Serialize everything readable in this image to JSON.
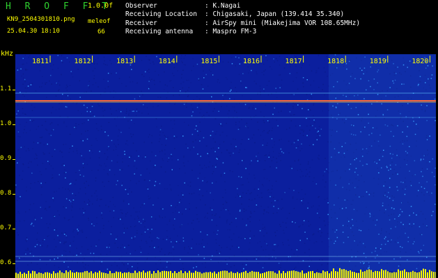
{
  "header": {
    "app_title": "H R O F F T",
    "version": "1.0.0f",
    "filename": "KN9_2504301810.png",
    "mode": "meleof",
    "datetime": "25.04.30 18:10",
    "count": "66"
  },
  "meta": [
    {
      "key": "Observer",
      "value": ": K.Nagai"
    },
    {
      "key": "Receiving Location",
      "value": ": Chigasaki, Japan (139.414 35.340)"
    },
    {
      "key": "Receiver",
      "value": ": AirSpy mini (Miakejima VOR 108.65MHz)"
    },
    {
      "key": "Receiving antenna",
      "value": ": Maspro FM-3"
    }
  ],
  "spectrogram": {
    "y_unit": "kHz",
    "y_ticks": [
      "1.1",
      "1.0",
      "0.9",
      "0.8",
      "0.7",
      "0.6"
    ],
    "x_ticks": [
      "1811",
      "1812",
      "1813",
      "1814",
      "1815",
      "1816",
      "1817",
      "1818",
      "1819",
      "1820"
    ],
    "colors": {
      "background": "#0b1f9e",
      "noise_dark": "#0a1a8a",
      "noise_light": "#3aa0ff",
      "signal": "#ff6a3a",
      "tick_label": "#ffff00",
      "baseline": "#ffff00"
    }
  }
}
